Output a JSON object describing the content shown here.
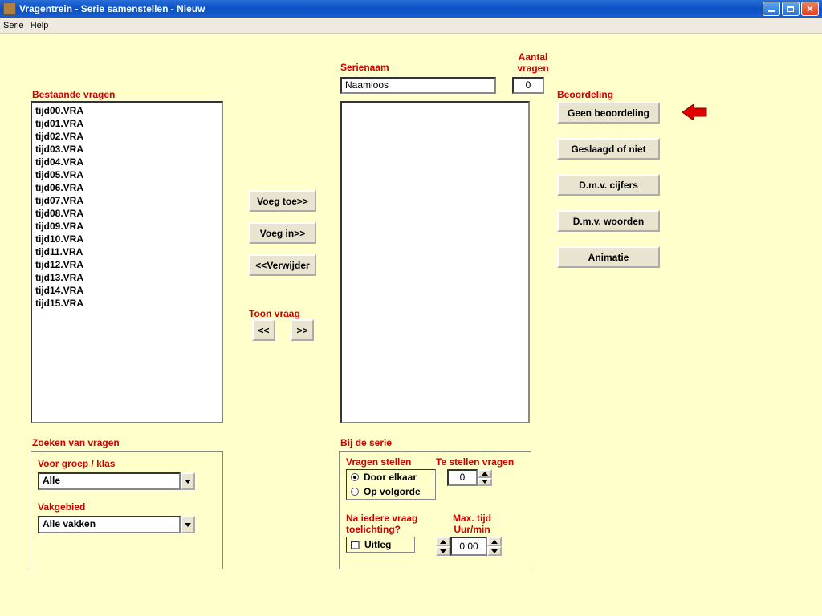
{
  "window": {
    "title": "Vragentrein - Serie samenstellen - Nieuw"
  },
  "menu": {
    "serie": "Serie",
    "help": "Help"
  },
  "labels": {
    "bestaande": "Bestaande vragen",
    "serienaam": "Serienaam",
    "aantal_vragen": "Aantal vragen",
    "beoordeling": "Beoordeling",
    "toon_vraag": "Toon vraag",
    "zoeken": "Zoeken van vragen",
    "voor_groep": "Voor groep / klas",
    "vakgebied": "Vakgebied",
    "bij_serie": "Bij de serie",
    "vragen_stellen": "Vragen stellen",
    "te_stellen": "Te stellen vragen",
    "na_iedere": "Na iedere vraag toelichting?",
    "max_tijd": "Max. tijd Uur/min"
  },
  "questions": [
    "tijd00.VRA",
    "tijd01.VRA",
    "tijd02.VRA",
    "tijd03.VRA",
    "tijd04.VRA",
    "tijd05.VRA",
    "tijd06.VRA",
    "tijd07.VRA",
    "tijd08.VRA",
    "tijd09.VRA",
    "tijd10.VRA",
    "tijd11.VRA",
    "tijd12.VRA",
    "tijd13.VRA",
    "tijd14.VRA",
    "tijd15.VRA"
  ],
  "serie": {
    "naam": "Naamloos",
    "aantal": "0"
  },
  "buttons": {
    "voeg_toe": "Voeg toe>>",
    "voeg_in": "Voeg in>>",
    "verwijder": "<<Verwijder",
    "prev": "<<",
    "next": ">>",
    "beoordeling1": "Geen beoordeling",
    "beoordeling2": "Geslaagd of niet",
    "beoordeling3": "D.m.v. cijfers",
    "beoordeling4": "D.m.v. woorden",
    "beoordeling5": "Animatie"
  },
  "zoeken": {
    "groep_selected": "Alle",
    "vak_selected": "Alle vakken"
  },
  "bij_serie": {
    "radio_door": "Door elkaar",
    "radio_op": "Op volgorde",
    "te_stellen_val": "0",
    "uitleg": "Uitleg",
    "tijd_val": "0:00"
  }
}
